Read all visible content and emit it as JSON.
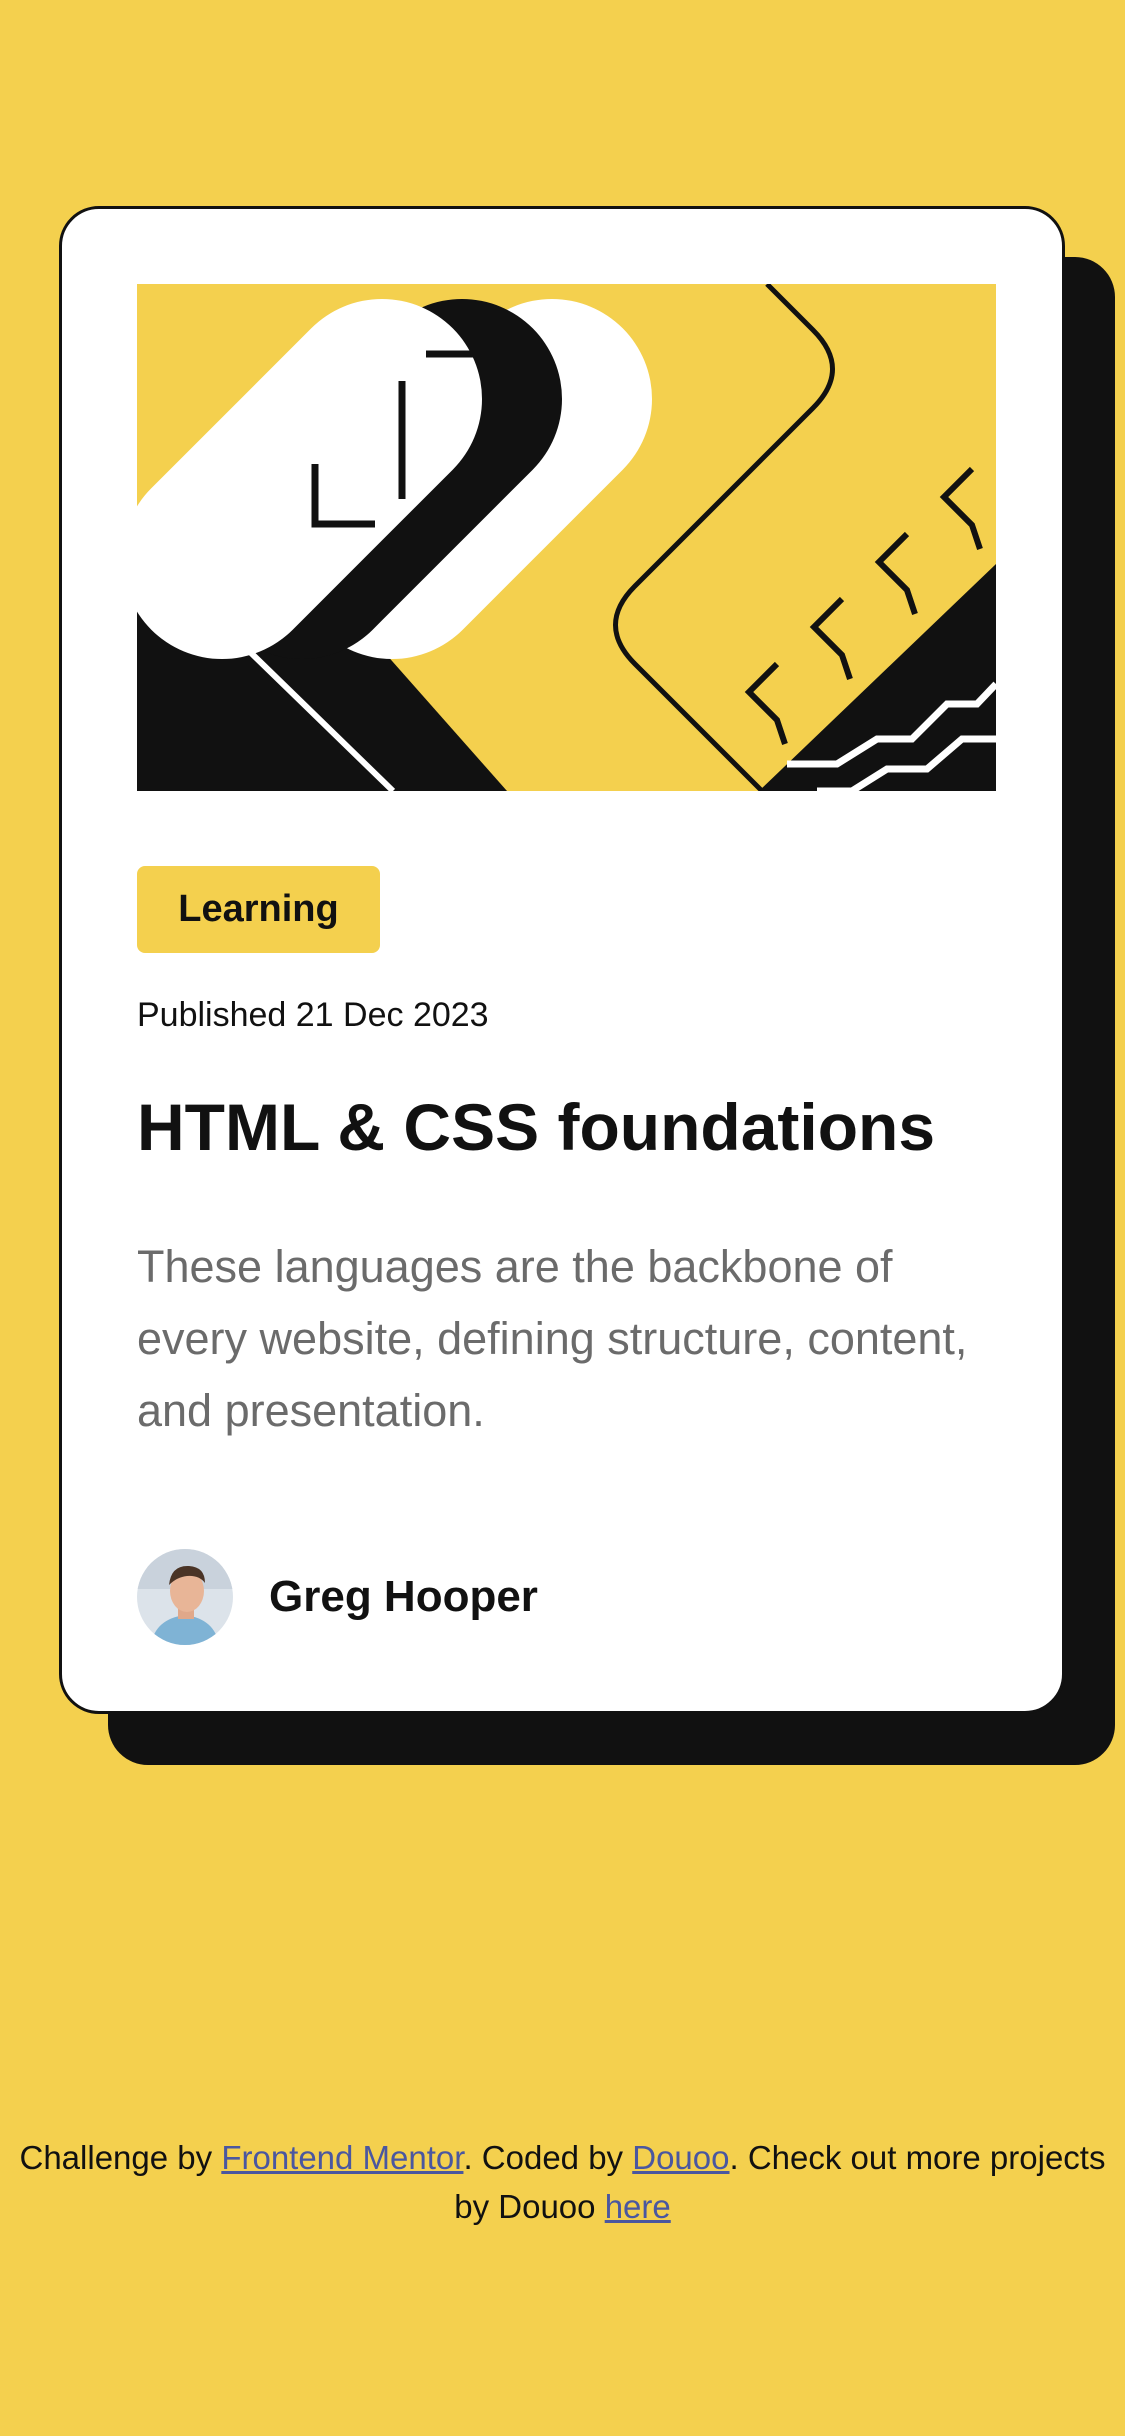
{
  "card": {
    "hero_image": "abstract-geometric-illustration",
    "tag": "Learning",
    "published": "Published 21 Dec 2023",
    "title": "HTML & CSS foundations",
    "description": "These languages are the backbone of every website, defining structure, content, and presentation.",
    "author": {
      "name": "Greg Hooper",
      "avatar": "author-avatar"
    }
  },
  "footer": {
    "text_1": "Challenge by ",
    "link_1": "Frontend Mentor",
    "text_2": ". Coded by ",
    "link_2": "Douoo",
    "text_3": ". Check out more projects by Douoo ",
    "link_3": "here"
  },
  "colors": {
    "background": "#F4D04E",
    "card": "#FFFFFF",
    "ink": "#111111",
    "muted_text": "#6B6B6B",
    "link": "#4A57A0"
  }
}
